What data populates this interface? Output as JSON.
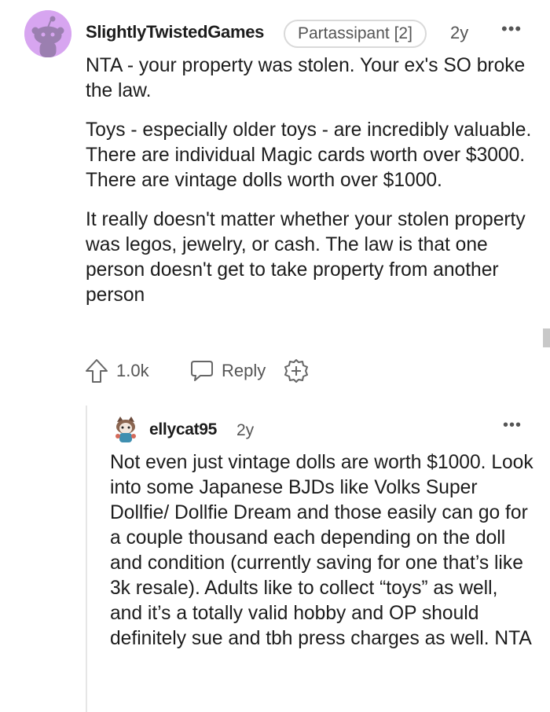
{
  "comment": {
    "username": "SlightlyTwistedGames",
    "flair": "Partassipant [2]",
    "age": "2y",
    "more": "•••",
    "paragraphs": [
      "NTA - your property was stolen. Your ex's SO broke the law.",
      "Toys - especially older toys - are incredibly valuable. There are individual Magic cards worth over $3000. There are vintage dolls worth over $1000.",
      "It really doesn't matter whether your stolen property was legos, jewelry, or cash. The law is that one person doesn't get to take property from another person"
    ],
    "upvote_count": "1.0k",
    "reply_label": "Reply",
    "avatar_color": "#d7a5f0"
  },
  "reply": {
    "username": "ellycat95",
    "age": "2y",
    "more": "•••",
    "text": "Not even just vintage dolls are worth $1000. Look into some Japanese BJDs like Volks Super Dollfie/ Dollfie Dream and those easily can go for a couple thousand each depending on the doll and condition (currently saving for one that’s like 3k resale). Adults like to collect “toys” as well, and it’s a totally valid hobby and OP should definitely sue and tbh press charges as well. NTA"
  },
  "icons": {
    "upvote": "upvote-arrow-icon",
    "reply": "speech-bubble-icon",
    "award": "plus-circle-icon"
  }
}
